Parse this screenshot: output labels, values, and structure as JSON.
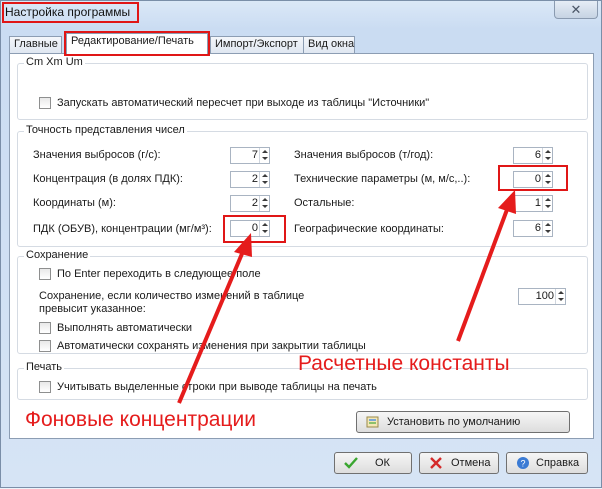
{
  "window": {
    "title": "Настройка программы",
    "close_glyph": "✕"
  },
  "tabs": [
    "Главные",
    "Редактирование/Печать",
    "Импорт/Экспорт",
    "Вид окна"
  ],
  "cm_group": {
    "title": "Cm Xm Um",
    "auto_recalc_label": "Запускать автоматический пересчет при выходе из таблицы \"Источники\""
  },
  "precision": {
    "title": "Точность представления чисел",
    "emissions_gs": {
      "label": "Значения выбросов (г/с):",
      "value": "7"
    },
    "concentration_pdk": {
      "label": "Концентрация (в долях ПДК):",
      "value": "2"
    },
    "coords_m": {
      "label": "Координаты (м):",
      "value": "2"
    },
    "pdk_obuv": {
      "label": "ПДК (ОБУВ), концентрации (мг/м³):",
      "value": "0"
    },
    "emissions_ty": {
      "label": "Значения выбросов (т/год):",
      "value": "6"
    },
    "tech_params": {
      "label": "Технические параметры (м, м/с,..):",
      "value": "0"
    },
    "others": {
      "label": "Остальные:",
      "value": "1"
    },
    "geo_coords": {
      "label": "Географические координаты:",
      "value": "6"
    }
  },
  "saving": {
    "title": "Сохранение",
    "enter_next_row": "По Enter переходить в следующее поле",
    "save_if_changes_line1": "Сохранение, если количество изменений в таблице",
    "save_if_changes_line2": "превысит указанное:",
    "save_if_changes_value": "100",
    "auto_execute": "Выполнять автоматически",
    "auto_save_on_close": "Автоматически сохранять изменения при закрытии таблицы"
  },
  "print": {
    "title": "Печать",
    "selected_rows": "Учитывать выделенные строки при выводе таблицы на печать"
  },
  "buttons": {
    "defaults": "Установить по умолчанию",
    "ok": "ОК",
    "cancel": "Отмена",
    "help": "Справка"
  },
  "annotations": {
    "calc_constants": "Расчетные константы",
    "background_conc": "Фоновые концентрации",
    "color": "#e51c1c"
  },
  "icons": [
    "close-icon",
    "defaults-icon",
    "ok-check-icon",
    "cancel-x-icon",
    "help-icon"
  ]
}
